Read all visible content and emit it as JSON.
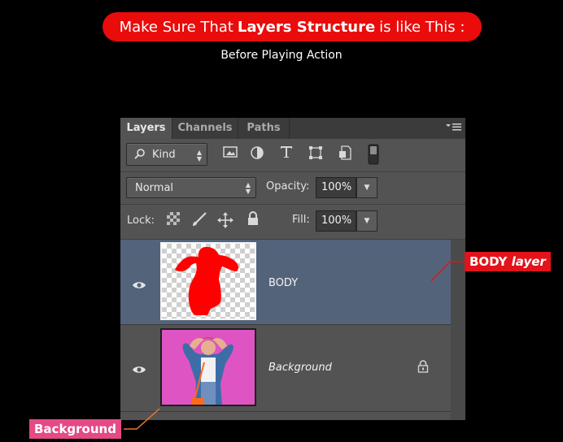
{
  "banner": {
    "prefix": "Make Sure That",
    "bold": "Layers Structure",
    "suffix": "is like This :"
  },
  "subtitle": "Before Playing Action",
  "panel": {
    "tabs": [
      {
        "label": "Layers",
        "active": true
      },
      {
        "label": "Channels",
        "active": false
      },
      {
        "label": "Paths",
        "active": false
      }
    ],
    "filter": {
      "kind_label": "Kind",
      "icons": [
        "image-filter-icon",
        "adjustment-filter-icon",
        "type-filter-icon",
        "shape-filter-icon",
        "smart-object-filter-icon",
        "filter-toggle-icon"
      ]
    },
    "blend_mode": "Normal",
    "opacity_label": "Opacity:",
    "opacity_value": "100%",
    "lock_label": "Lock:",
    "fill_label": "Fill:",
    "fill_value": "100%",
    "layers": [
      {
        "name": "BODY",
        "selected": true,
        "visible": true,
        "locked": false
      },
      {
        "name": "Background",
        "selected": false,
        "visible": true,
        "locked": true
      }
    ]
  },
  "callouts": {
    "body_bold": "BODY",
    "body_italic": "layer",
    "background": "Background",
    "body_color": "#e2131a",
    "background_color": "#e44a86",
    "line_color": "#e8772a"
  }
}
